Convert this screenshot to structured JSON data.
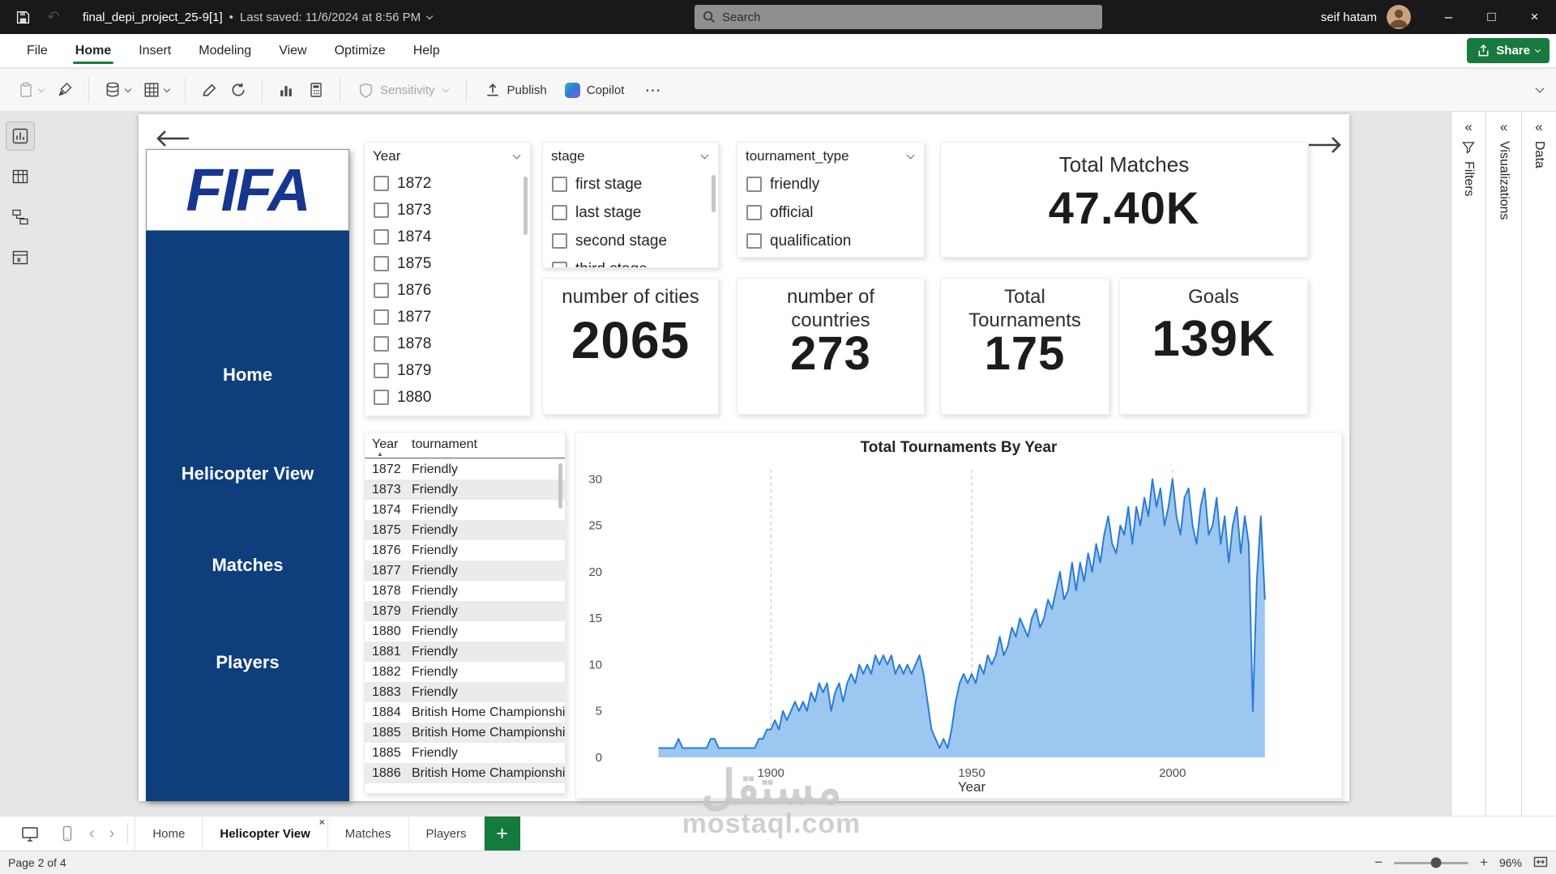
{
  "titlebar": {
    "file_name": "final_depi_project_25-9[1]",
    "bullet": "•",
    "last_saved": "Last saved: 11/6/2024 at 8:56 PM",
    "search_placeholder": "Search",
    "user_name": "seif hatam"
  },
  "icons": {
    "undo": "↶",
    "minimize": "–",
    "maximize": "□",
    "close": "×",
    "more": "⋯",
    "collapse_left": "«",
    "page_prev": "‹",
    "page_next": "›",
    "sort_asc": "▲",
    "add_page": "+",
    "minus": "−",
    "plus": "+"
  },
  "menubar": {
    "items": [
      {
        "label": "File",
        "active": false
      },
      {
        "label": "Home",
        "active": true
      },
      {
        "label": "Insert",
        "active": false
      },
      {
        "label": "Modeling",
        "active": false
      },
      {
        "label": "View",
        "active": false
      },
      {
        "label": "Optimize",
        "active": false
      },
      {
        "label": "Help",
        "active": false
      }
    ],
    "share_label": "Share"
  },
  "ribbon": {
    "sensitivity_label": "Sensitivity",
    "publish_label": "Publish",
    "copilot_label": "Copilot"
  },
  "report": {
    "nav": {
      "logo": "FIFA",
      "items": [
        "Home",
        "Helicopter View",
        "Matches",
        "Players"
      ]
    },
    "slicers": {
      "year": {
        "title": "Year",
        "options": [
          "1872",
          "1873",
          "1874",
          "1875",
          "1876",
          "1877",
          "1878",
          "1879",
          "1880"
        ]
      },
      "stage": {
        "title": "stage",
        "options": [
          "first stage",
          "last stage",
          "second stage",
          "third stage"
        ]
      },
      "tournament_type": {
        "title": "tournament_type",
        "options": [
          "friendly",
          "official",
          "qualification"
        ]
      }
    },
    "cards": [
      {
        "label": "Total Matches",
        "value": "47.40K"
      },
      {
        "label": "number of cities",
        "value": "2065"
      },
      {
        "label": "number of countries",
        "value": "273"
      },
      {
        "label": "Total Tournaments",
        "value": "175"
      },
      {
        "label": "Goals",
        "value": "139K"
      }
    ],
    "table": {
      "columns": [
        "Year",
        "tournament"
      ],
      "rows": [
        [
          "1872",
          "Friendly"
        ],
        [
          "1873",
          "Friendly"
        ],
        [
          "1874",
          "Friendly"
        ],
        [
          "1875",
          "Friendly"
        ],
        [
          "1876",
          "Friendly"
        ],
        [
          "1877",
          "Friendly"
        ],
        [
          "1878",
          "Friendly"
        ],
        [
          "1879",
          "Friendly"
        ],
        [
          "1880",
          "Friendly"
        ],
        [
          "1881",
          "Friendly"
        ],
        [
          "1882",
          "Friendly"
        ],
        [
          "1883",
          "Friendly"
        ],
        [
          "1884",
          "British Home Championship"
        ],
        [
          "1885",
          "British Home Championship"
        ],
        [
          "1885",
          "Friendly"
        ],
        [
          "1886",
          "British Home Championship"
        ]
      ]
    }
  },
  "chart_data": {
    "type": "area",
    "title": "Total Tournaments By Year",
    "xlabel": "Year",
    "series_name": "Total Tournaments",
    "xlim": [
      1860,
      2040
    ],
    "ylim": [
      0,
      31
    ],
    "x_ticks": [
      1900,
      1950,
      2000
    ],
    "y_ticks": [
      0,
      5,
      10,
      15,
      20,
      25,
      30
    ],
    "grid": "vertical-dashed",
    "line_color": "#2b7cd6",
    "fill_color": "#9cc7f1",
    "points": [
      [
        1872,
        1
      ],
      [
        1874,
        1
      ],
      [
        1876,
        1
      ],
      [
        1877,
        2
      ],
      [
        1878,
        1
      ],
      [
        1880,
        1
      ],
      [
        1882,
        1
      ],
      [
        1884,
        1
      ],
      [
        1885,
        2
      ],
      [
        1886,
        2
      ],
      [
        1887,
        1
      ],
      [
        1888,
        1
      ],
      [
        1890,
        1
      ],
      [
        1892,
        1
      ],
      [
        1894,
        1
      ],
      [
        1896,
        1
      ],
      [
        1897,
        2
      ],
      [
        1898,
        2
      ],
      [
        1899,
        3
      ],
      [
        1900,
        3
      ],
      [
        1901,
        4
      ],
      [
        1902,
        3
      ],
      [
        1903,
        5
      ],
      [
        1904,
        4
      ],
      [
        1905,
        5
      ],
      [
        1906,
        6
      ],
      [
        1907,
        5
      ],
      [
        1908,
        6
      ],
      [
        1909,
        5
      ],
      [
        1910,
        7
      ],
      [
        1911,
        6
      ],
      [
        1912,
        8
      ],
      [
        1913,
        7
      ],
      [
        1914,
        8
      ],
      [
        1915,
        5
      ],
      [
        1916,
        7
      ],
      [
        1917,
        8
      ],
      [
        1918,
        6
      ],
      [
        1919,
        8
      ],
      [
        1920,
        9
      ],
      [
        1921,
        8
      ],
      [
        1922,
        10
      ],
      [
        1923,
        9
      ],
      [
        1924,
        10
      ],
      [
        1925,
        9
      ],
      [
        1926,
        11
      ],
      [
        1927,
        10
      ],
      [
        1928,
        11
      ],
      [
        1929,
        10
      ],
      [
        1930,
        11
      ],
      [
        1931,
        9
      ],
      [
        1932,
        10
      ],
      [
        1933,
        9
      ],
      [
        1934,
        10
      ],
      [
        1935,
        9
      ],
      [
        1936,
        10
      ],
      [
        1937,
        11
      ],
      [
        1938,
        9
      ],
      [
        1939,
        6
      ],
      [
        1940,
        3
      ],
      [
        1941,
        2
      ],
      [
        1942,
        1
      ],
      [
        1943,
        2
      ],
      [
        1944,
        1
      ],
      [
        1945,
        3
      ],
      [
        1946,
        6
      ],
      [
        1947,
        8
      ],
      [
        1948,
        9
      ],
      [
        1949,
        8
      ],
      [
        1950,
        9
      ],
      [
        1951,
        8
      ],
      [
        1952,
        10
      ],
      [
        1953,
        9
      ],
      [
        1954,
        11
      ],
      [
        1955,
        10
      ],
      [
        1956,
        11
      ],
      [
        1957,
        13
      ],
      [
        1958,
        11
      ],
      [
        1959,
        12
      ],
      [
        1960,
        14
      ],
      [
        1961,
        13
      ],
      [
        1962,
        15
      ],
      [
        1963,
        14
      ],
      [
        1964,
        13
      ],
      [
        1965,
        15
      ],
      [
        1966,
        16
      ],
      [
        1967,
        14
      ],
      [
        1968,
        15
      ],
      [
        1969,
        17
      ],
      [
        1970,
        16
      ],
      [
        1971,
        18
      ],
      [
        1972,
        20
      ],
      [
        1973,
        17
      ],
      [
        1974,
        18
      ],
      [
        1975,
        21
      ],
      [
        1976,
        18
      ],
      [
        1977,
        21
      ],
      [
        1978,
        19
      ],
      [
        1979,
        22
      ],
      [
        1980,
        20
      ],
      [
        1981,
        23
      ],
      [
        1982,
        21
      ],
      [
        1983,
        24
      ],
      [
        1984,
        26
      ],
      [
        1985,
        23
      ],
      [
        1986,
        22
      ],
      [
        1987,
        25
      ],
      [
        1988,
        24
      ],
      [
        1989,
        27
      ],
      [
        1990,
        23
      ],
      [
        1991,
        27
      ],
      [
        1992,
        25
      ],
      [
        1993,
        28
      ],
      [
        1994,
        26
      ],
      [
        1995,
        30
      ],
      [
        1996,
        27
      ],
      [
        1997,
        29
      ],
      [
        1998,
        25
      ],
      [
        1999,
        27
      ],
      [
        2000,
        30
      ],
      [
        2001,
        26
      ],
      [
        2002,
        24
      ],
      [
        2003,
        28
      ],
      [
        2004,
        29
      ],
      [
        2005,
        25
      ],
      [
        2006,
        23
      ],
      [
        2007,
        27
      ],
      [
        2008,
        29
      ],
      [
        2009,
        24
      ],
      [
        2010,
        25
      ],
      [
        2011,
        28
      ],
      [
        2012,
        23
      ],
      [
        2013,
        26
      ],
      [
        2014,
        21
      ],
      [
        2015,
        25
      ],
      [
        2016,
        27
      ],
      [
        2017,
        22
      ],
      [
        2018,
        26
      ],
      [
        2019,
        23
      ],
      [
        2020,
        5
      ],
      [
        2021,
        19
      ],
      [
        2022,
        26
      ],
      [
        2023,
        17
      ]
    ]
  },
  "pages_bar": {
    "tabs": [
      {
        "label": "Home",
        "active": false
      },
      {
        "label": "Helicopter View",
        "active": true
      },
      {
        "label": "Matches",
        "active": false
      },
      {
        "label": "Players",
        "active": false
      }
    ]
  },
  "statusbar": {
    "page_info": "Page 2 of 4",
    "zoom": "96%"
  },
  "side_panels": {
    "filters": "Filters",
    "visualizations": "Visualizations",
    "data": "Data"
  },
  "watermark": {
    "arabic": "مستقل",
    "latin": "mostaql.com"
  }
}
